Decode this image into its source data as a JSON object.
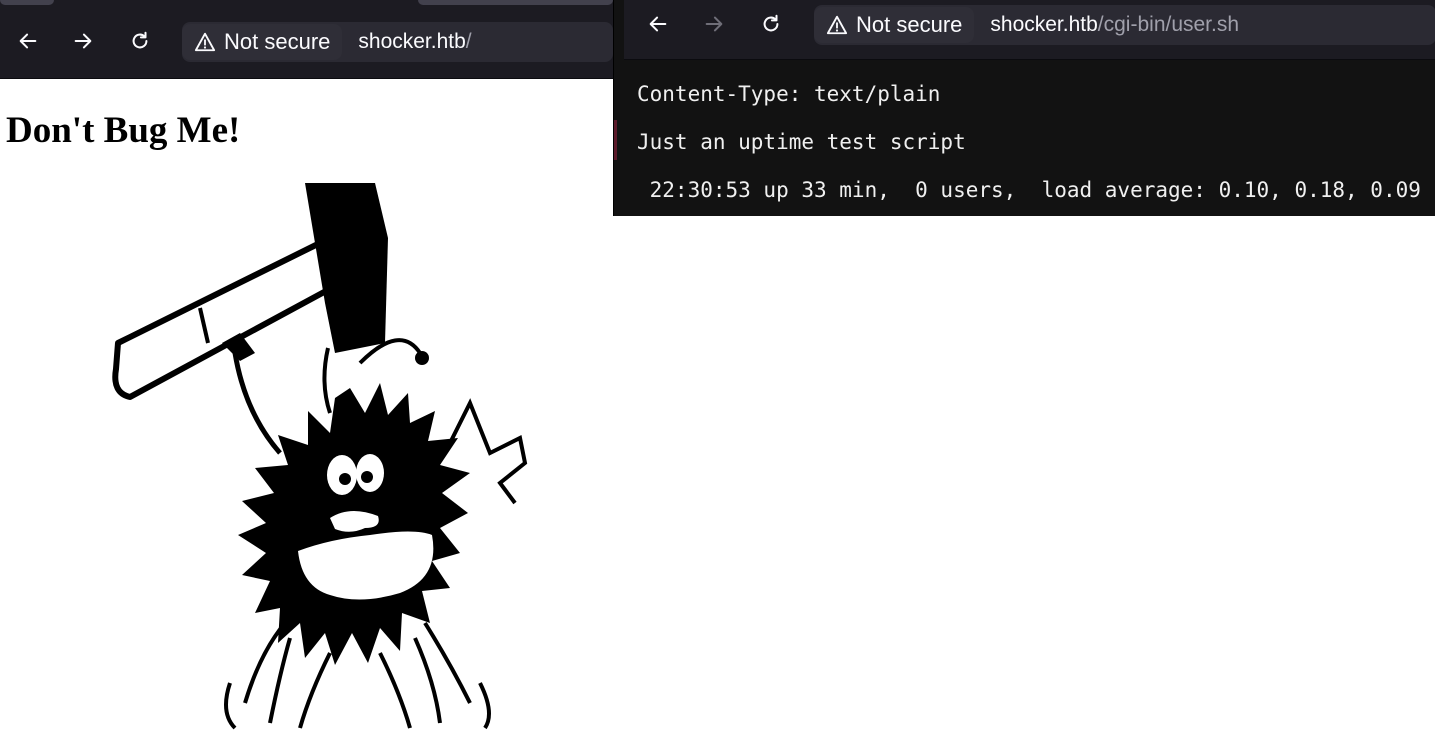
{
  "left_window": {
    "security_label": "Not secure",
    "url": "shocker.htb",
    "url_suffix": "/",
    "heading": "Don't Bug Me!"
  },
  "right_window": {
    "security_label": "Not secure",
    "url_host": "shocker.htb",
    "url_path": "/cgi-bin/user.sh",
    "lines": [
      "Content-Type: text/plain",
      "Just an uptime test script",
      " 22:30:53 up 33 min,  0 users,  load average: 0.10, 0.18, 0.09"
    ]
  },
  "icons": {
    "back": "arrow-left-icon",
    "forward": "arrow-right-icon",
    "reload": "reload-icon",
    "warning": "warning-triangle-icon"
  }
}
